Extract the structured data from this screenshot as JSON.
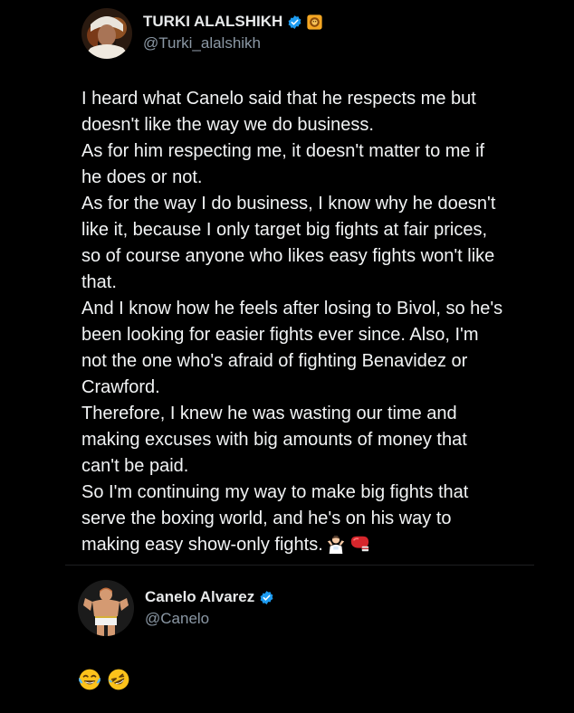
{
  "post": {
    "author": {
      "display_name": "TURKI ALALSHIKH",
      "handle": "@Turki_alalshikh",
      "verified_icon": "verified-badge-icon",
      "affiliate_icon": "lion-affiliate-badge-icon"
    },
    "text_lines": [
      "I heard what Canelo said that he respects me but",
      "doesn't like the way we do business.",
      "As for him respecting me, it doesn't matter to me if",
      "he does or not.",
      "As for the way I do business, I know why he doesn't",
      "like it, because I only target big fights at fair prices,",
      "so of course anyone who likes easy fights won't like",
      "that.",
      "And I know how he feels after losing to Bivol, so he's",
      "been looking for easier fights ever since. Also, I'm",
      "not the one who's afraid of fighting Benavidez or",
      "Crawford.",
      "Therefore, I knew he was wasting our time and",
      "making excuses with big amounts of money that",
      "can't be paid.",
      "So I'm continuing my way to make big fights that",
      "serve the boxing world, and he's on his way to",
      "making easy show-only fights."
    ],
    "trailing_emojis": [
      "man-shrugging-emoji",
      "boxing-glove-emoji"
    ]
  },
  "quoted": {
    "author": {
      "display_name": "Canelo Alvarez",
      "handle": "@Canelo",
      "verified_icon": "verified-badge-icon"
    },
    "reply_emojis": [
      "face-with-tears-of-joy-emoji",
      "rolling-on-floor-laughing-emoji"
    ]
  },
  "colors": {
    "background": "#000000",
    "text_primary": "#e7e9ea",
    "text_secondary": "#8b98a5",
    "verified_blue": "#1d9bf0",
    "affiliate_gold": "#f4a623"
  }
}
